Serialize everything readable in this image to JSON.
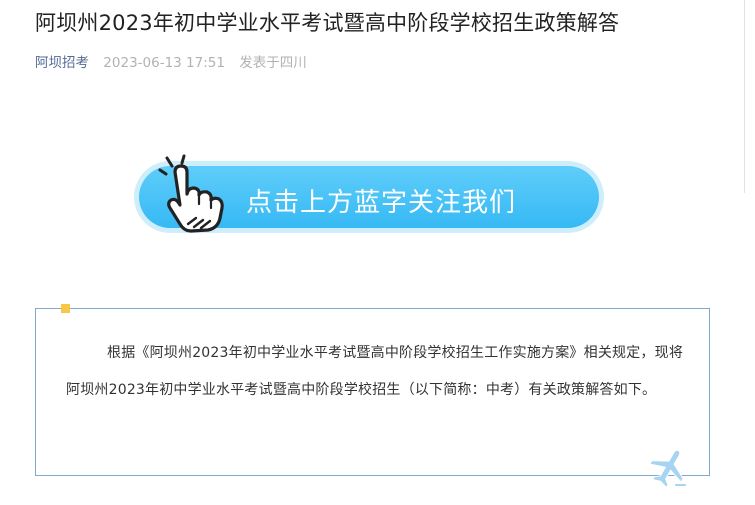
{
  "article": {
    "title": "阿坝州2023年初中学业水平考试暨高中阶段学校招生政策解答",
    "account_name": "阿坝招考",
    "publish_time": "2023-06-13 17:51",
    "location": "发表于四川"
  },
  "banner": {
    "text": "点击上方蓝字关注我们",
    "icon": "pointing-hand-icon"
  },
  "intro": {
    "paragraph": "根据《阿坝州2023年初中学业水平考试暨高中阶段学校招生工作实施方案》相关规定，现将阿坝州2023年初中学业水平考试暨高中阶段学校招生（以下简称：中考）有关政策解答如下。",
    "decoration_icon": "airplane-icon"
  },
  "colors": {
    "account_link": "#576b95",
    "banner_blue": "#36b9f4",
    "box_border": "#7fa8cc",
    "corner_accent": "#f7c746"
  }
}
